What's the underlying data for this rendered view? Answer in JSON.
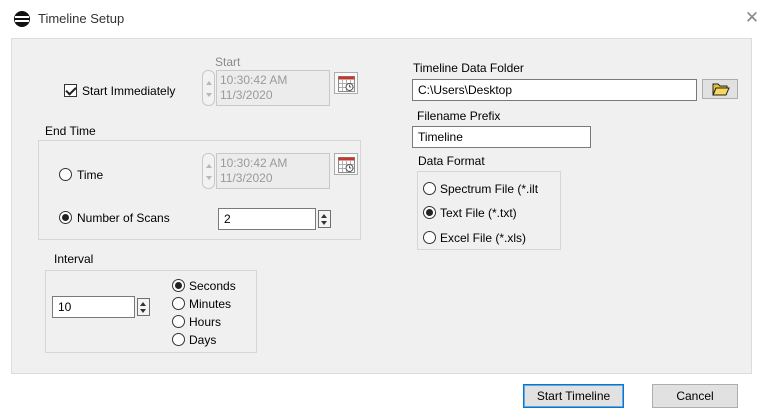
{
  "window": {
    "title": "Timeline Setup",
    "close_glyph": "✕"
  },
  "start": {
    "section_label": "Start",
    "immediately_label": "Start Immediately",
    "immediately_checked": true,
    "time": "10:30:42 AM",
    "date": "11/3/2020"
  },
  "end_time": {
    "section_label": "End Time",
    "time_option_label": "Time",
    "time_value": "10:30:42 AM",
    "date_value": "11/3/2020",
    "scans_option_label": "Number of Scans",
    "scans_value": "2",
    "selected": "scans"
  },
  "interval": {
    "section_label": "Interval",
    "value": "10",
    "units": [
      "Seconds",
      "Minutes",
      "Hours",
      "Days"
    ],
    "selected_unit": "Seconds"
  },
  "data_folder": {
    "label": "Timeline Data Folder",
    "value": "C:\\Users\\Desktop"
  },
  "prefix": {
    "label": "Filename Prefix",
    "value": "Timeline"
  },
  "data_format": {
    "label": "Data Format",
    "options": [
      "Spectrum File (*.ilt",
      "Text File (*.txt)",
      "Excel File (*.xls)"
    ],
    "selected": "Text File (*.txt)"
  },
  "buttons": {
    "start_label": "Start Timeline",
    "cancel_label": "Cancel"
  },
  "icons": {
    "app": "lens-icon",
    "calendar": "calendar-icon",
    "folder": "folder-open-icon"
  }
}
